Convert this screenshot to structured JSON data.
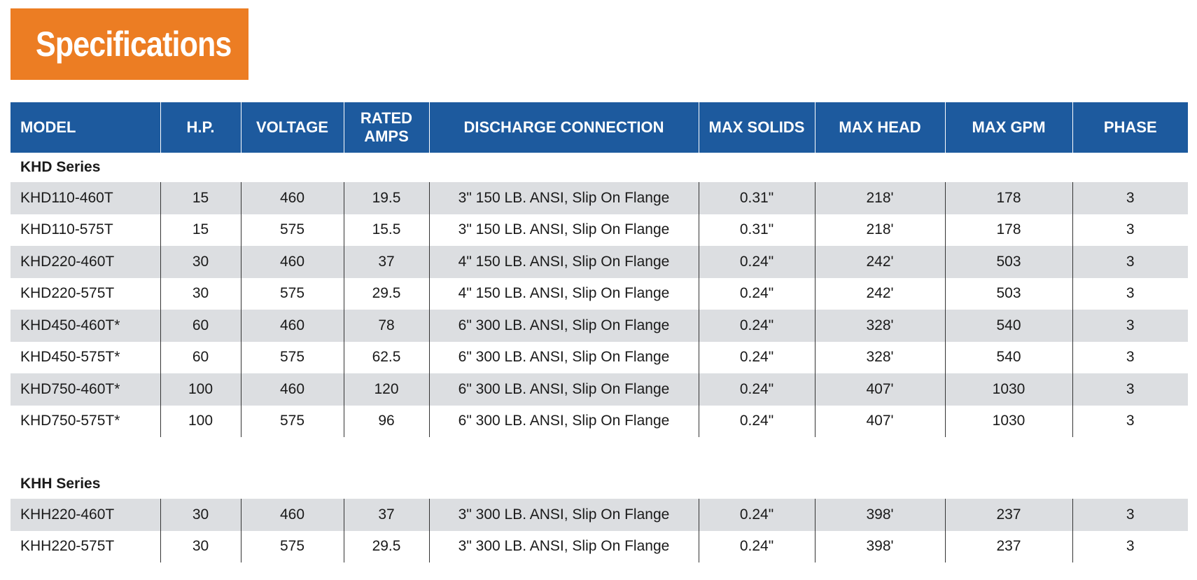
{
  "title": "Specifications",
  "table": {
    "headers": {
      "model": "MODEL",
      "hp": "H.P.",
      "voltage": "VOLTAGE",
      "rated_amps_line1": "RATED",
      "rated_amps_line2": "AMPS",
      "discharge": "DISCHARGE CONNECTION",
      "max_solids": "MAX SOLIDS",
      "max_head": "MAX HEAD",
      "max_gpm": "MAX GPM",
      "phase": "PHASE"
    },
    "khd": {
      "label": "KHD Series",
      "rows": [
        {
          "model": "KHD110-460T",
          "hp": "15",
          "voltage": "460",
          "amps": "19.5",
          "discharge": "3\" 150 LB. ANSI, Slip On Flange",
          "solids": "0.31\"",
          "head": "218'",
          "gpm": "178",
          "phase": "3"
        },
        {
          "model": "KHD110-575T",
          "hp": "15",
          "voltage": "575",
          "amps": "15.5",
          "discharge": "3\" 150 LB. ANSI, Slip On Flange",
          "solids": "0.31\"",
          "head": "218'",
          "gpm": "178",
          "phase": "3"
        },
        {
          "model": "KHD220-460T",
          "hp": "30",
          "voltage": "460",
          "amps": "37",
          "discharge": "4\" 150 LB. ANSI, Slip On Flange",
          "solids": "0.24\"",
          "head": "242'",
          "gpm": "503",
          "phase": "3"
        },
        {
          "model": "KHD220-575T",
          "hp": "30",
          "voltage": "575",
          "amps": "29.5",
          "discharge": "4\" 150 LB. ANSI, Slip On Flange",
          "solids": "0.24\"",
          "head": "242'",
          "gpm": "503",
          "phase": "3"
        },
        {
          "model": "KHD450-460T*",
          "hp": "60",
          "voltage": "460",
          "amps": "78",
          "discharge": "6\" 300 LB. ANSI, Slip On Flange",
          "solids": "0.24\"",
          "head": "328'",
          "gpm": "540",
          "phase": "3"
        },
        {
          "model": "KHD450-575T*",
          "hp": "60",
          "voltage": "575",
          "amps": "62.5",
          "discharge": "6\" 300 LB. ANSI, Slip On Flange",
          "solids": "0.24\"",
          "head": "328'",
          "gpm": "540",
          "phase": "3"
        },
        {
          "model": "KHD750-460T*",
          "hp": "100",
          "voltage": "460",
          "amps": "120",
          "discharge": "6\" 300 LB. ANSI, Slip On Flange",
          "solids": "0.24\"",
          "head": "407'",
          "gpm": "1030",
          "phase": "3"
        },
        {
          "model": "KHD750-575T*",
          "hp": "100",
          "voltage": "575",
          "amps": "96",
          "discharge": "6\" 300 LB. ANSI, Slip On Flange",
          "solids": "0.24\"",
          "head": "407'",
          "gpm": "1030",
          "phase": "3"
        }
      ]
    },
    "khh": {
      "label": "KHH Series",
      "rows": [
        {
          "model": "KHH220-460T",
          "hp": "30",
          "voltage": "460",
          "amps": "37",
          "discharge": "3\" 300 LB. ANSI, Slip On Flange",
          "solids": "0.24\"",
          "head": "398'",
          "gpm": "237",
          "phase": "3"
        },
        {
          "model": "KHH220-575T",
          "hp": "30",
          "voltage": "575",
          "amps": "29.5",
          "discharge": "3\" 300 LB. ANSI, Slip On Flange",
          "solids": "0.24\"",
          "head": "398'",
          "gpm": "237",
          "phase": "3"
        }
      ]
    }
  }
}
